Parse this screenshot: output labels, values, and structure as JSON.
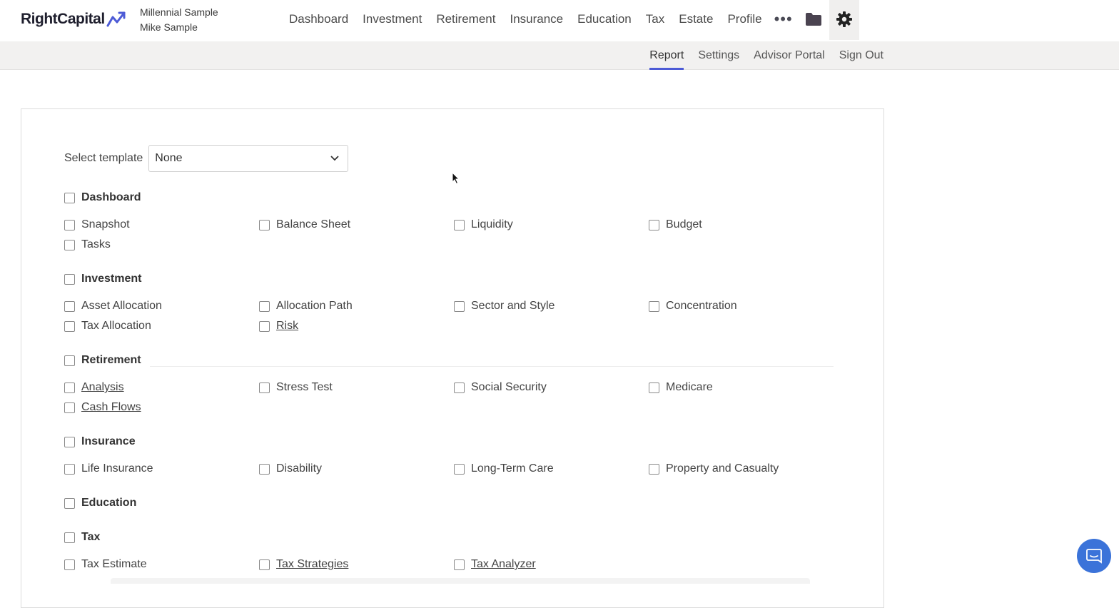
{
  "brand": {
    "name": "RightCapital",
    "accent": "#4d5bd6"
  },
  "client": {
    "household": "Millennial Sample",
    "name": "Mike Sample"
  },
  "nav": {
    "items": [
      "Dashboard",
      "Investment",
      "Retirement",
      "Insurance",
      "Education",
      "Tax",
      "Estate",
      "Profile"
    ],
    "more_icon": "more-icon",
    "folder_icon": "folder-icon",
    "settings_icon": "gear-icon"
  },
  "subnav": {
    "items": [
      "Report",
      "Settings",
      "Advisor Portal",
      "Sign Out"
    ],
    "active": "Report"
  },
  "template": {
    "label": "Select template",
    "value": "None"
  },
  "sections": [
    {
      "title": "Dashboard",
      "items": [
        {
          "label": "Snapshot",
          "link": false
        },
        {
          "label": "Balance Sheet",
          "link": false
        },
        {
          "label": "Liquidity",
          "link": false
        },
        {
          "label": "Budget",
          "link": false
        },
        {
          "label": "Tasks",
          "link": false
        }
      ]
    },
    {
      "title": "Investment",
      "items": [
        {
          "label": "Asset Allocation",
          "link": false
        },
        {
          "label": "Allocation Path",
          "link": false
        },
        {
          "label": "Sector and Style",
          "link": false
        },
        {
          "label": "Concentration",
          "link": false
        },
        {
          "label": "Tax Allocation",
          "link": false
        },
        {
          "label": "Risk",
          "link": true
        }
      ]
    },
    {
      "title": "Retirement",
      "items": [
        {
          "label": "Analysis",
          "link": true
        },
        {
          "label": "Stress Test",
          "link": false
        },
        {
          "label": "Social Security",
          "link": false
        },
        {
          "label": "Medicare",
          "link": false
        },
        {
          "label": "Cash Flows",
          "link": true
        }
      ]
    },
    {
      "title": "Insurance",
      "items": [
        {
          "label": "Life Insurance",
          "link": false
        },
        {
          "label": "Disability",
          "link": false
        },
        {
          "label": "Long-Term Care",
          "link": false
        },
        {
          "label": "Property and Casualty",
          "link": false
        }
      ]
    },
    {
      "title": "Education",
      "items": []
    },
    {
      "title": "Tax",
      "items": [
        {
          "label": "Tax Estimate",
          "link": false
        },
        {
          "label": "Tax Strategies",
          "link": true
        },
        {
          "label": "Tax Analyzer",
          "link": true
        }
      ]
    }
  ]
}
